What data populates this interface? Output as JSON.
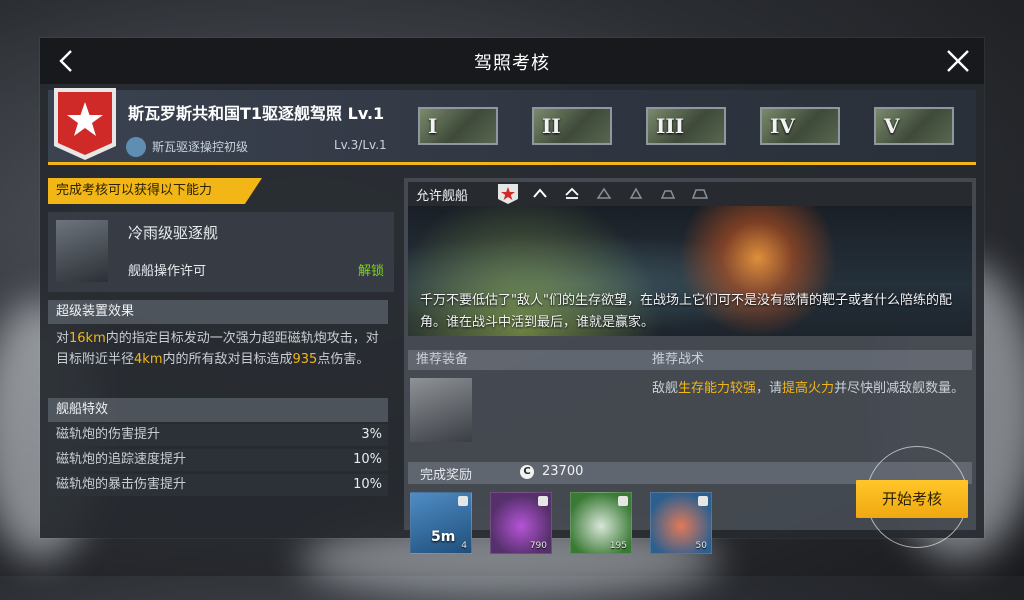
{
  "dialog": {
    "title": "驾照考核",
    "back_icon": "chevron-left-icon",
    "close_icon": "close-icon"
  },
  "license": {
    "title": "斯瓦罗斯共和国T1驱逐舰驾照 Lv.1",
    "skill_name": "斯瓦驱逐操控初级",
    "skill_level": "Lv.3/Lv.1",
    "tiers": [
      "I",
      "II",
      "III",
      "IV",
      "V"
    ]
  },
  "gain": {
    "banner": "完成考核可以获得以下能力",
    "ship_name": "冷雨级驱逐舰",
    "permit": "舰船操作许可",
    "status": "解锁"
  },
  "super_device": {
    "heading": "超级装置效果",
    "desc_parts": [
      "对",
      "16km",
      "内的指定目标发动一次强力超距磁轨炮攻击，对目标附近半径",
      "4km",
      "内的所有敌对目标造成",
      "935",
      "点伤害。"
    ]
  },
  "ship_traits": {
    "heading": "舰船特效",
    "rows": [
      {
        "label": "磁轨炮的伤害提升",
        "value": "3%"
      },
      {
        "label": "磁轨炮的追踪速度提升",
        "value": "10%"
      },
      {
        "label": "磁轨炮的暴击伤害提升",
        "value": "10%"
      }
    ]
  },
  "allowed": {
    "label": "允许舰船",
    "flavor": "千万不要低估了\"敌人\"们的生存欲望，在战场上它们可不是没有感情的靶子或者什么陪练的配角。谁在战斗中活到最后，谁就是赢家。"
  },
  "recommend": {
    "equip_heading": "推荐装备",
    "tactic_heading": "推荐战术",
    "tactic_parts": [
      "敌舰",
      "生存能力较强",
      "，请",
      "提高火力",
      "并尽快削减敌舰数量。"
    ]
  },
  "reward": {
    "label": "完成奖励",
    "coin_symbol": "C",
    "value": "23700",
    "items": [
      {
        "name": "5m",
        "qty": "4",
        "color": "#2f6fa8"
      },
      {
        "name": "",
        "qty": "790",
        "color": "#6d3f86"
      },
      {
        "name": "",
        "qty": "195",
        "color": "#3e7d3a"
      },
      {
        "name": "",
        "qty": "50",
        "color": "#2f6fa8"
      }
    ]
  },
  "start_button": "开始考核",
  "colors": {
    "accent": "#f2b616",
    "unlock": "#7ed321",
    "highlight": "#f2b616"
  }
}
